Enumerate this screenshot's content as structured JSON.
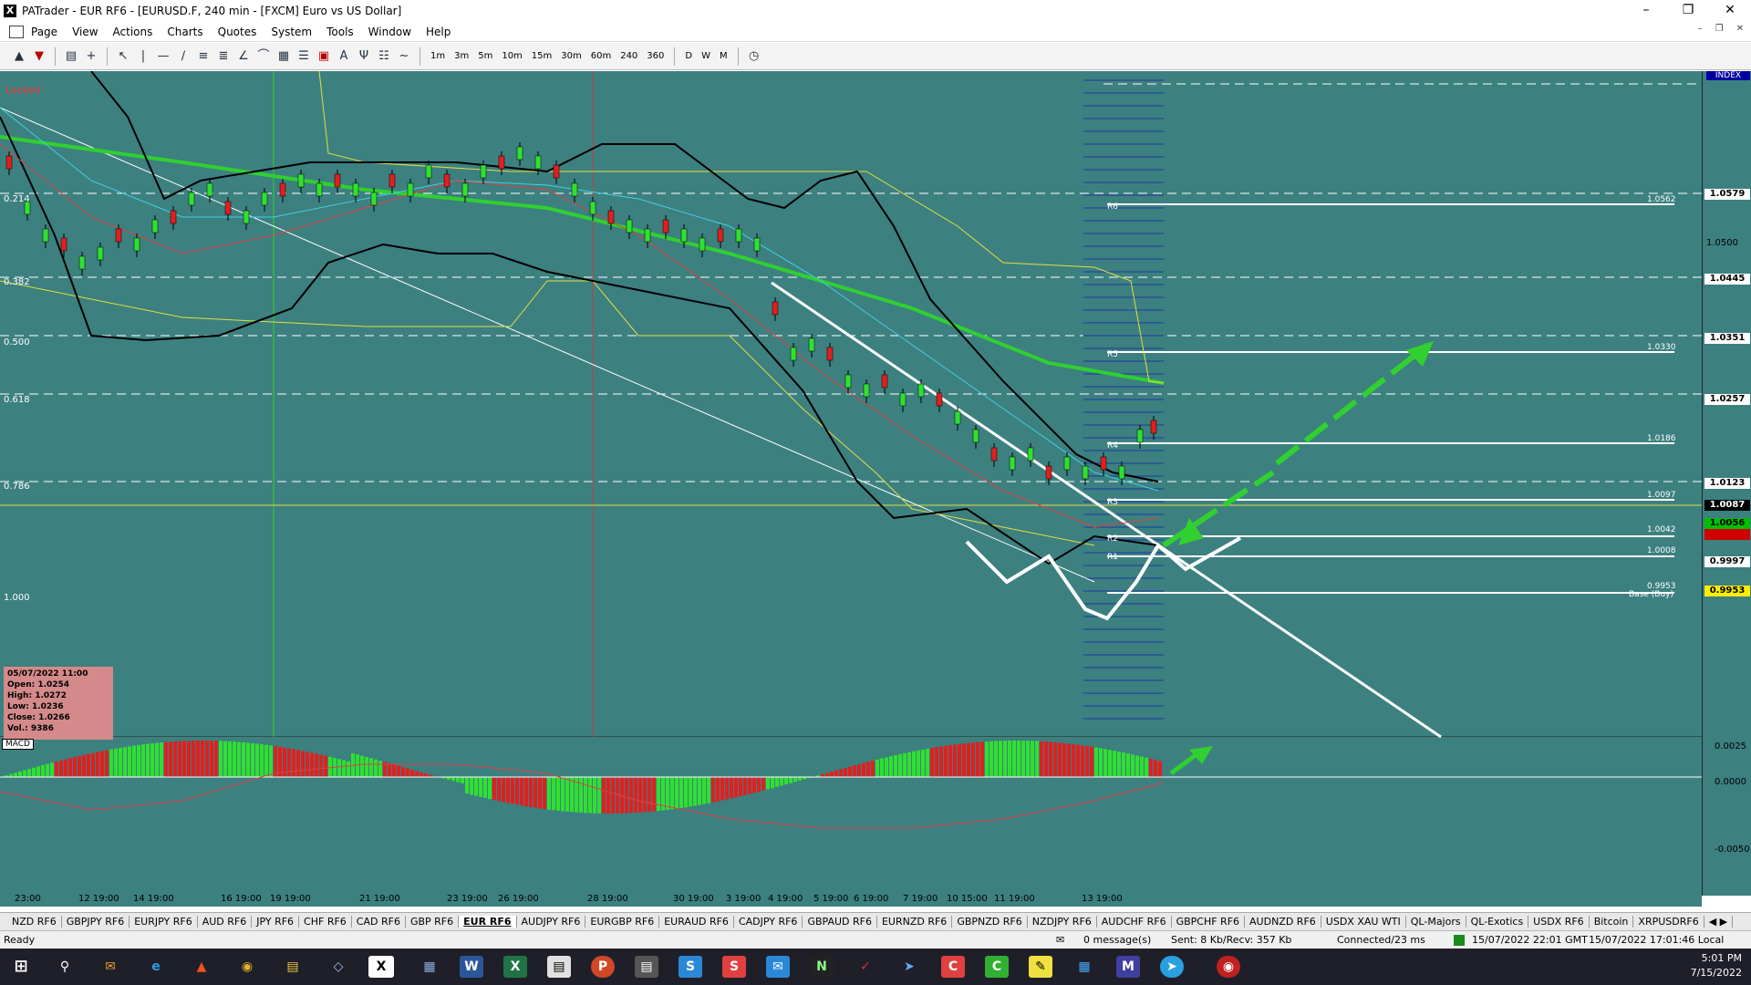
{
  "window": {
    "title": "PATrader - EUR RF6 - [EURUSD.F, 240 min - [FXCM] Euro vs US Dollar]"
  },
  "menu": [
    "Page",
    "View",
    "Actions",
    "Charts",
    "Quotes",
    "System",
    "Tools",
    "Window",
    "Help"
  ],
  "timeframes": [
    "1m",
    "3m",
    "5m",
    "10m",
    "15m",
    "30m",
    "60m",
    "240",
    "360",
    "D",
    "W",
    "M"
  ],
  "chart": {
    "locked": "Locked",
    "fib_levels": [
      {
        "label": "0.214"
      },
      {
        "label": "0.382"
      },
      {
        "label": "0.500"
      },
      {
        "label": "0.618"
      },
      {
        "label": "0.786"
      },
      {
        "label": "1.000"
      }
    ],
    "price_labels": [
      "1.0579",
      "1.0500",
      "1.0445",
      "1.0351",
      "1.0257",
      "1.0123",
      "1.0087",
      "1.0056",
      "0.9997",
      "0.9953"
    ],
    "index_label": "INDEX",
    "pivots": [
      {
        "name": "R6",
        "value": "1.0562"
      },
      {
        "name": "R5",
        "value": "1.0330"
      },
      {
        "name": "R4",
        "value": "1.0186"
      },
      {
        "name": "R3",
        "value": "1.0097"
      },
      {
        "name": "R2",
        "value": "1.0042"
      },
      {
        "name": "R1",
        "value": "1.0008"
      },
      {
        "name": "Base (Buy)",
        "value": "0.9953"
      }
    ],
    "info": {
      "date": "05/07/2022 11:00",
      "open": "Open: 1.0254",
      "high": "High: 1.0272",
      "low": "Low: 1.0236",
      "close": "Close: 1.0266",
      "vol": "Vol.: 9386"
    },
    "macd_label": "MACD",
    "macd_axis": [
      "0.0025",
      "0.0000",
      "-0.0050"
    ],
    "time_labels": [
      "23:00",
      "12 19:00",
      "14 19:00",
      "16 19:00",
      "19 19:00",
      "21 19:00",
      "23 19:00",
      "26 19:00",
      "28 19:00",
      "30 19:00",
      "3 19:00",
      "4 19:00",
      "5 19:00",
      "6 19:00",
      "7 19:00",
      "10 15:00",
      "11 19:00",
      "13 19:00"
    ]
  },
  "tabs": [
    "NZD RF6",
    "GBPJPY RF6",
    "EURJPY RF6",
    "AUD RF6",
    "JPY RF6",
    "CHF RF6",
    "CAD RF6",
    "GBP RF6",
    "EUR RF6",
    "AUDJPY RF6",
    "EURGBP RF6",
    "EURAUD RF6",
    "CADJPY RF6",
    "GBPAUD RF6",
    "EURNZD RF6",
    "GBPNZD RF6",
    "NZDJPY RF6",
    "AUDCHF RF6",
    "GBPCHF RF6",
    "AUDNZD RF6",
    "USDX XAU WTI",
    "QL-Majors",
    "QL-Exotics",
    "USDX RF6",
    "Bitcoin",
    "XRPUSDRF6"
  ],
  "active_tab": "EUR RF6",
  "status": {
    "ready": "Ready",
    "messages": "0 message(s)",
    "traffic": "Sent: 8 Kb/Recv: 357 Kb",
    "connected": "Connected/23 ms",
    "server_time": "15/07/2022 22:01 GMT",
    "local_time": "15/07/2022 17:01:46 Local"
  },
  "clock": {
    "time": "5:01 PM",
    "date": "7/15/2022"
  }
}
